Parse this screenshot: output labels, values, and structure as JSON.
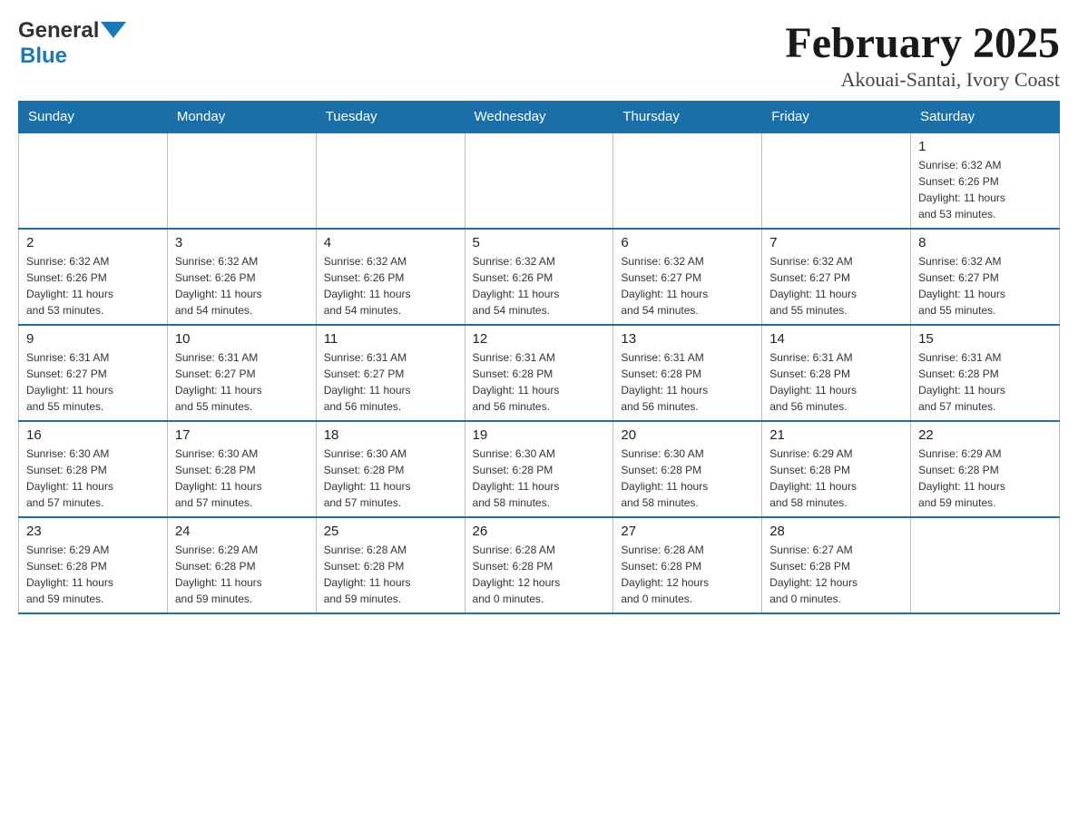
{
  "header": {
    "logo_general": "General",
    "logo_blue": "Blue",
    "title": "February 2025",
    "subtitle": "Akouai-Santai, Ivory Coast"
  },
  "days_of_week": [
    "Sunday",
    "Monday",
    "Tuesday",
    "Wednesday",
    "Thursday",
    "Friday",
    "Saturday"
  ],
  "weeks": [
    [
      {
        "day": "",
        "info": ""
      },
      {
        "day": "",
        "info": ""
      },
      {
        "day": "",
        "info": ""
      },
      {
        "day": "",
        "info": ""
      },
      {
        "day": "",
        "info": ""
      },
      {
        "day": "",
        "info": ""
      },
      {
        "day": "1",
        "info": "Sunrise: 6:32 AM\nSunset: 6:26 PM\nDaylight: 11 hours\nand 53 minutes."
      }
    ],
    [
      {
        "day": "2",
        "info": "Sunrise: 6:32 AM\nSunset: 6:26 PM\nDaylight: 11 hours\nand 53 minutes."
      },
      {
        "day": "3",
        "info": "Sunrise: 6:32 AM\nSunset: 6:26 PM\nDaylight: 11 hours\nand 54 minutes."
      },
      {
        "day": "4",
        "info": "Sunrise: 6:32 AM\nSunset: 6:26 PM\nDaylight: 11 hours\nand 54 minutes."
      },
      {
        "day": "5",
        "info": "Sunrise: 6:32 AM\nSunset: 6:26 PM\nDaylight: 11 hours\nand 54 minutes."
      },
      {
        "day": "6",
        "info": "Sunrise: 6:32 AM\nSunset: 6:27 PM\nDaylight: 11 hours\nand 54 minutes."
      },
      {
        "day": "7",
        "info": "Sunrise: 6:32 AM\nSunset: 6:27 PM\nDaylight: 11 hours\nand 55 minutes."
      },
      {
        "day": "8",
        "info": "Sunrise: 6:32 AM\nSunset: 6:27 PM\nDaylight: 11 hours\nand 55 minutes."
      }
    ],
    [
      {
        "day": "9",
        "info": "Sunrise: 6:31 AM\nSunset: 6:27 PM\nDaylight: 11 hours\nand 55 minutes."
      },
      {
        "day": "10",
        "info": "Sunrise: 6:31 AM\nSunset: 6:27 PM\nDaylight: 11 hours\nand 55 minutes."
      },
      {
        "day": "11",
        "info": "Sunrise: 6:31 AM\nSunset: 6:27 PM\nDaylight: 11 hours\nand 56 minutes."
      },
      {
        "day": "12",
        "info": "Sunrise: 6:31 AM\nSunset: 6:28 PM\nDaylight: 11 hours\nand 56 minutes."
      },
      {
        "day": "13",
        "info": "Sunrise: 6:31 AM\nSunset: 6:28 PM\nDaylight: 11 hours\nand 56 minutes."
      },
      {
        "day": "14",
        "info": "Sunrise: 6:31 AM\nSunset: 6:28 PM\nDaylight: 11 hours\nand 56 minutes."
      },
      {
        "day": "15",
        "info": "Sunrise: 6:31 AM\nSunset: 6:28 PM\nDaylight: 11 hours\nand 57 minutes."
      }
    ],
    [
      {
        "day": "16",
        "info": "Sunrise: 6:30 AM\nSunset: 6:28 PM\nDaylight: 11 hours\nand 57 minutes."
      },
      {
        "day": "17",
        "info": "Sunrise: 6:30 AM\nSunset: 6:28 PM\nDaylight: 11 hours\nand 57 minutes."
      },
      {
        "day": "18",
        "info": "Sunrise: 6:30 AM\nSunset: 6:28 PM\nDaylight: 11 hours\nand 57 minutes."
      },
      {
        "day": "19",
        "info": "Sunrise: 6:30 AM\nSunset: 6:28 PM\nDaylight: 11 hours\nand 58 minutes."
      },
      {
        "day": "20",
        "info": "Sunrise: 6:30 AM\nSunset: 6:28 PM\nDaylight: 11 hours\nand 58 minutes."
      },
      {
        "day": "21",
        "info": "Sunrise: 6:29 AM\nSunset: 6:28 PM\nDaylight: 11 hours\nand 58 minutes."
      },
      {
        "day": "22",
        "info": "Sunrise: 6:29 AM\nSunset: 6:28 PM\nDaylight: 11 hours\nand 59 minutes."
      }
    ],
    [
      {
        "day": "23",
        "info": "Sunrise: 6:29 AM\nSunset: 6:28 PM\nDaylight: 11 hours\nand 59 minutes."
      },
      {
        "day": "24",
        "info": "Sunrise: 6:29 AM\nSunset: 6:28 PM\nDaylight: 11 hours\nand 59 minutes."
      },
      {
        "day": "25",
        "info": "Sunrise: 6:28 AM\nSunset: 6:28 PM\nDaylight: 11 hours\nand 59 minutes."
      },
      {
        "day": "26",
        "info": "Sunrise: 6:28 AM\nSunset: 6:28 PM\nDaylight: 12 hours\nand 0 minutes."
      },
      {
        "day": "27",
        "info": "Sunrise: 6:28 AM\nSunset: 6:28 PM\nDaylight: 12 hours\nand 0 minutes."
      },
      {
        "day": "28",
        "info": "Sunrise: 6:27 AM\nSunset: 6:28 PM\nDaylight: 12 hours\nand 0 minutes."
      },
      {
        "day": "",
        "info": ""
      }
    ]
  ]
}
